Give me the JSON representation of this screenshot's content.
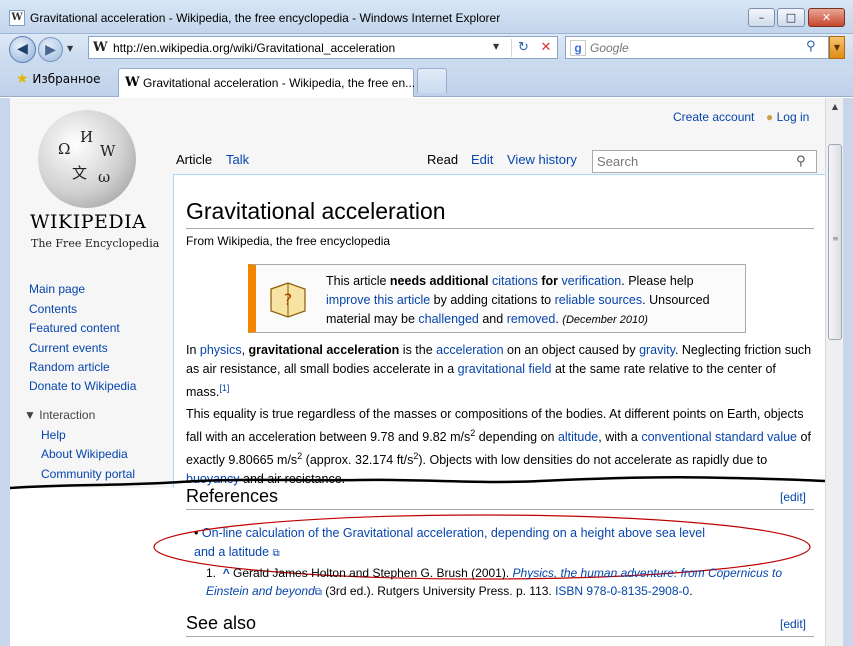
{
  "window": {
    "title": "Gravitational acceleration - Wikipedia, the free encyclopedia - Windows Internet Explorer",
    "min": "–",
    "max": "□",
    "close": "✕"
  },
  "navigation": {
    "back_icon": "◀",
    "forward_icon": "▶",
    "dropdown": "▼",
    "url": "http://en.wikipedia.org/wiki/Gravitational_acceleration",
    "site_icon": "W",
    "refresh_icon": "↻",
    "stop_icon": "✕",
    "search_provider": "g",
    "search_placeholder": "Google",
    "search_go": "⚲"
  },
  "tabs": {
    "favorites_label": "Избранное",
    "favorites_icon": "★",
    "active_tab_title": "Gravitational acceleration - Wikipedia, the free en..."
  },
  "logo": {
    "wordmark": "WIKIPEDIA",
    "tagline": "The Free Encyclopedia"
  },
  "sidebar": {
    "nav": [
      "Main page",
      "Contents",
      "Featured content",
      "Current events",
      "Random article",
      "Donate to Wikipedia"
    ],
    "interaction_header": "Interaction",
    "interaction": [
      "Help",
      "About Wikipedia",
      "Community portal"
    ]
  },
  "personal": {
    "create_account": "Create account",
    "login": "Log in"
  },
  "page_tabs": {
    "article": "Article",
    "talk": "Talk",
    "read": "Read",
    "edit": "Edit",
    "history": "View history",
    "search_placeholder": "Search"
  },
  "article": {
    "title": "Gravitational acceleration",
    "from": "From Wikipedia, the free encyclopedia",
    "ambox": {
      "t1": "This article ",
      "b1": "needs additional ",
      "l1": "citations",
      "t2": " ",
      "b2": "for ",
      "l2": "verification",
      "t3": ". Please help ",
      "l3": "improve this article",
      "t4": " by adding citations to ",
      "l4": "reliable sources",
      "t5": ". Unsourced material may be ",
      "l5": "challenged",
      "t6": " and ",
      "l6": "removed",
      "t7": ". ",
      "date": "(December 2010)"
    },
    "p1": {
      "t1": "In ",
      "l1": "physics",
      "t2": ", ",
      "b1": "gravitational acceleration",
      "t3": " is the ",
      "l2": "acceleration",
      "t4": " on an object caused by ",
      "l3": "gravity",
      "t5": ". Neglecting friction such as air resistance, all small bodies accelerate in a ",
      "l4": "gravitational field",
      "t6": " at the same rate relative to the center of mass.",
      "ref": "[1]"
    },
    "p2": {
      "t1": "This equality is true regardless of the masses or compositions of the bodies. At different points on Earth, objects fall with an acceleration between 9.78 and 9.82 m/s",
      "sup1": "2",
      "t2": " depending on ",
      "l1": "altitude",
      "t3": ", with a ",
      "l2": "conventional standard value",
      "t4": " of exactly 9.80665 m/s",
      "sup2": "2",
      "t5": " (approx. 32.174 ft/s",
      "sup3": "2",
      "t6": "). Objects with low densities do not accelerate as rapidly due to ",
      "l3": "buoyancy",
      "t7": " and air resistance."
    },
    "references_heading": "References",
    "edit_label": "[edit]",
    "ref_link": "On-line calculation of the Gravitational acceleration, depending on a height above sea level and a latitude",
    "ref1": {
      "num": "1.",
      "caret": "^",
      "t1": " Gerald James Holton and Stephen G. Brush (2001). ",
      "l1": "Physics, the human adventure: from Copernicus to Einstein and beyond",
      "t2": " (3rd ed.). Rutgers University Press. p. 113. ",
      "l2": "ISBN 978-0-8135-2908-0",
      "t3": "."
    },
    "see_also_heading": "See also"
  },
  "colors": {
    "link": "#0645ad",
    "ambox_accent": "#f28500",
    "annotation": "#c00000"
  }
}
